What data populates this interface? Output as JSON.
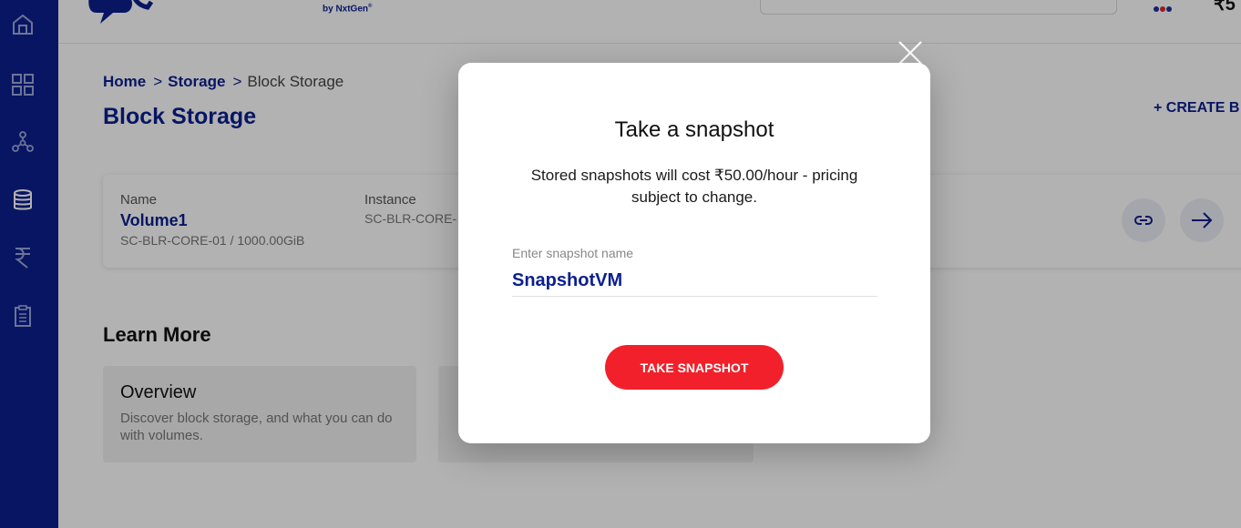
{
  "brand": {
    "sub": "by NxtGen",
    "sup": "®"
  },
  "topbar": {
    "balance": "₹5"
  },
  "breadcrumb": {
    "home": "Home",
    "sep": ">",
    "storage": "Storage",
    "current": "Block Storage"
  },
  "page": {
    "title": "Block Storage",
    "create_label": "+ CREATE B"
  },
  "volume_card": {
    "name_label": "Name",
    "name_value": "Volume1",
    "name_sub": "SC-BLR-CORE-01 / 1000.00GiB",
    "instance_label": "Instance",
    "instance_sub": "SC-BLR-CORE-"
  },
  "learn_more": {
    "heading": "Learn More",
    "cards": [
      {
        "title": "Overview",
        "desc": "Discover block storage, and what you can do with volumes."
      },
      {
        "title": "",
        "desc": ""
      }
    ]
  },
  "modal": {
    "title": "Take a snapshot",
    "desc": "Stored snapshots will cost ₹50.00/hour - pricing subject to change.",
    "field_label": "Enter snapshot name",
    "field_value": "SnapshotVM",
    "button_label": "TAKE SNAPSHOT"
  },
  "colors": {
    "sidebar": "#0b1f8f",
    "primary": "#0b1f8f",
    "accent_button": "#f2202a"
  }
}
